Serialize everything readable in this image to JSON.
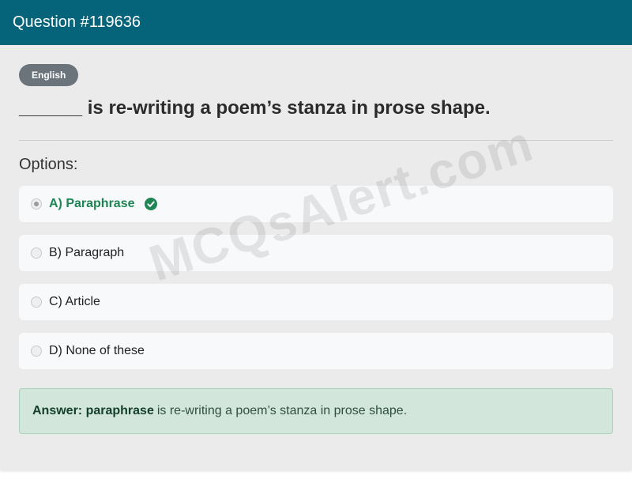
{
  "header": {
    "title": "Question #119636"
  },
  "badge": {
    "label": "English"
  },
  "question": {
    "text": "______ is re-writing a poem’s stanza in prose shape."
  },
  "options_title": "Options:",
  "options": [
    {
      "label": "A) Paraphrase",
      "selected": true,
      "correct": true
    },
    {
      "label": "B) Paragraph",
      "selected": false,
      "correct": false
    },
    {
      "label": "C) Article",
      "selected": false,
      "correct": false
    },
    {
      "label": "D) None of these",
      "selected": false,
      "correct": false
    }
  ],
  "answer": {
    "prefix": "Answer: paraphrase",
    "text": "is re-writing a poem’s stanza in prose shape."
  },
  "watermark": "MCQsAlert.com",
  "colors": {
    "header": "#05637a",
    "correct": "#1e8553",
    "answer_bg": "#d2e6dc"
  },
  "icons": {
    "correct": "check-circle-icon"
  }
}
